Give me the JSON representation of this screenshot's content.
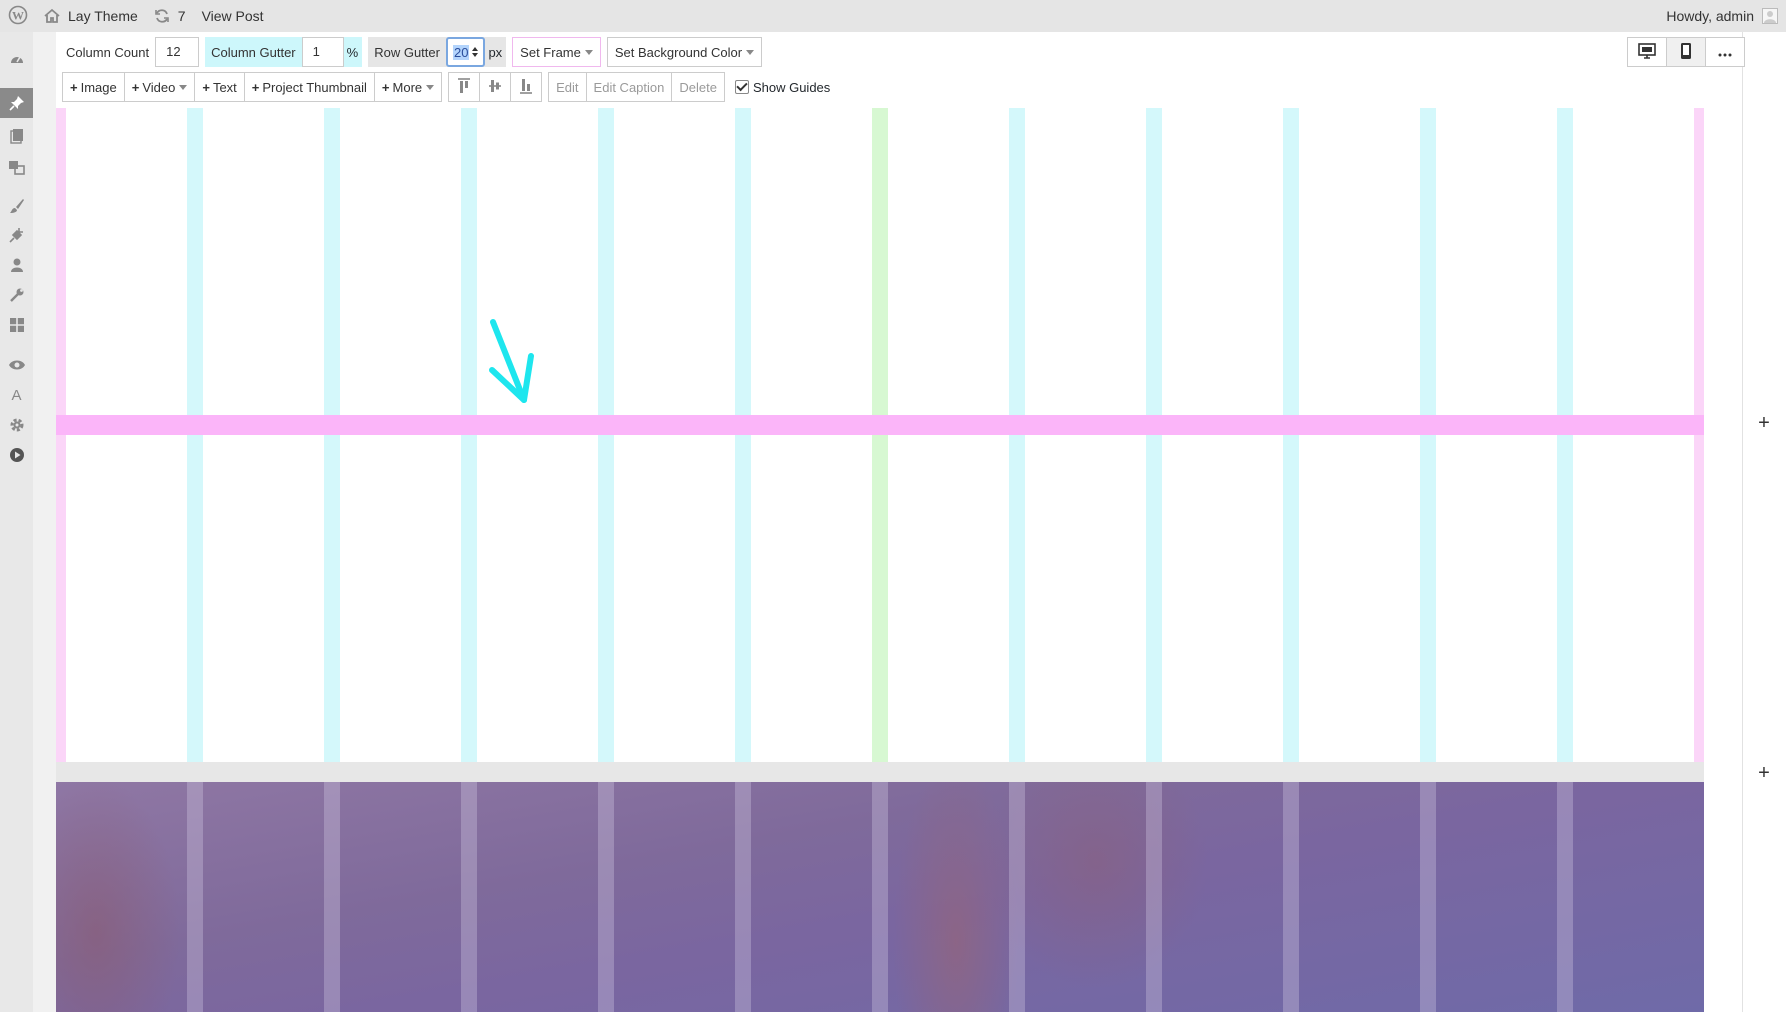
{
  "admin_bar": {
    "site_name": "Lay Theme",
    "updates_count": "7",
    "view_post": "View Post",
    "greeting": "Howdy, admin"
  },
  "toolbar_row1": {
    "column_count_label": "Column Count",
    "column_count_value": "12",
    "column_gutter_label": "Column Gutter",
    "column_gutter_value": "1",
    "column_gutter_unit": "%",
    "row_gutter_label": "Row Gutter",
    "row_gutter_value": "20",
    "row_gutter_unit": "px",
    "set_frame": "Set Frame",
    "set_background_color": "Set Background Color"
  },
  "toolbar_row2": {
    "add_image": "Image",
    "add_video": "Video",
    "add_text": "Text",
    "add_project_thumbnail": "Project Thumbnail",
    "more": "More",
    "edit": "Edit",
    "edit_caption": "Edit Caption",
    "delete": "Delete",
    "show_guides": "Show Guides"
  },
  "view_controls": {
    "desktop_icon": "desktop-icon",
    "phone_icon": "phone-icon",
    "more_icon": "ellipsis-icon"
  },
  "grid": {
    "columns": 12,
    "add_row_symbol": "+"
  },
  "colors": {
    "column_gutter": "#d4f8fb",
    "center_gutter": "#d7f8d2",
    "frame": "#fbd5f8",
    "row_gutter": "#fbb5f9",
    "arrow": "#1ee6ee",
    "active_menu": "#8a8a8a"
  }
}
